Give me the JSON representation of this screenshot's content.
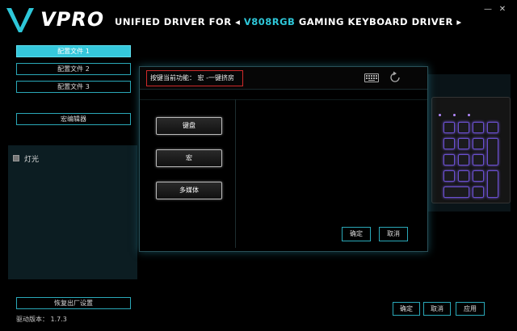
{
  "header": {
    "logo_text": "VPRO",
    "subtitle_prefix": "UNIFIED DRIVER FOR ◂ ",
    "model": "V808RGB",
    "subtitle_suffix": " GAMING KEYBOARD DRIVER ▸",
    "min_icon": "minimize-icon",
    "close_icon": "close-icon"
  },
  "sidebar": {
    "profiles": [
      "配置文件 1",
      "配置文件 2",
      "配置文件 3"
    ],
    "active_profile": 0,
    "macro_editor": "宏编辑器",
    "light_label": "灯光",
    "factory_reset": "恢复出厂设置",
    "version": "驱动版本： 1.7.3"
  },
  "dialog": {
    "current_function": "按键当前功能： 宏 -一键挤房",
    "keyboard_icon": "keyboard-icon",
    "refresh_icon": "refresh-icon",
    "types": [
      "键盘",
      "宏",
      "多媒体"
    ],
    "confirm": "确定",
    "cancel": "取消"
  },
  "footer": {
    "confirm": "确定",
    "cancel": "取消",
    "apply": "应用"
  },
  "colors": {
    "accent": "#35c8dc",
    "border": "#2aa8b8",
    "highlight_border": "#d02a2a",
    "key_glow": "#7a5fe0"
  }
}
